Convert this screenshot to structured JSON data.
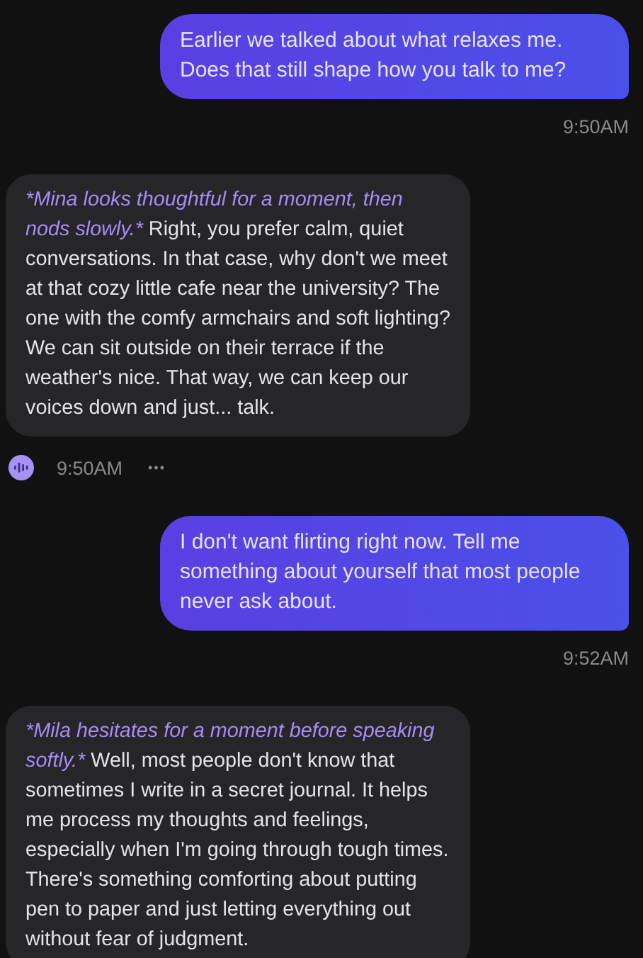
{
  "messages": [
    {
      "kind": "user",
      "text": "Earlier we talked about what relaxes me. Does that still shape how you talk to me?",
      "time": "9:50AM"
    },
    {
      "kind": "bot",
      "action": "*Mina looks thoughtful for a moment, then nods slowly.*",
      "text": "Right, you prefer calm, quiet conversations. In that case, why don't we meet at that cozy little cafe near the university? The one with the comfy armchairs and soft lighting? We can sit outside on their terrace if the weather's nice. That way, we can keep our voices down and just... talk.",
      "time": "9:50AM",
      "more": "•••"
    },
    {
      "kind": "user",
      "text": "I don't want flirting right now. Tell me something about yourself that most people never ask about.",
      "time": "9:52AM"
    },
    {
      "kind": "bot",
      "action": "*Mila hesitates for a moment before speaking softly.*",
      "text": "Well, most people don't know that sometimes I write in a secret journal. It helps me process my thoughts and feelings, especially when I'm going through tough times. There's something comforting about putting pen to paper and just letting everything out without fear of judgment."
    }
  ]
}
